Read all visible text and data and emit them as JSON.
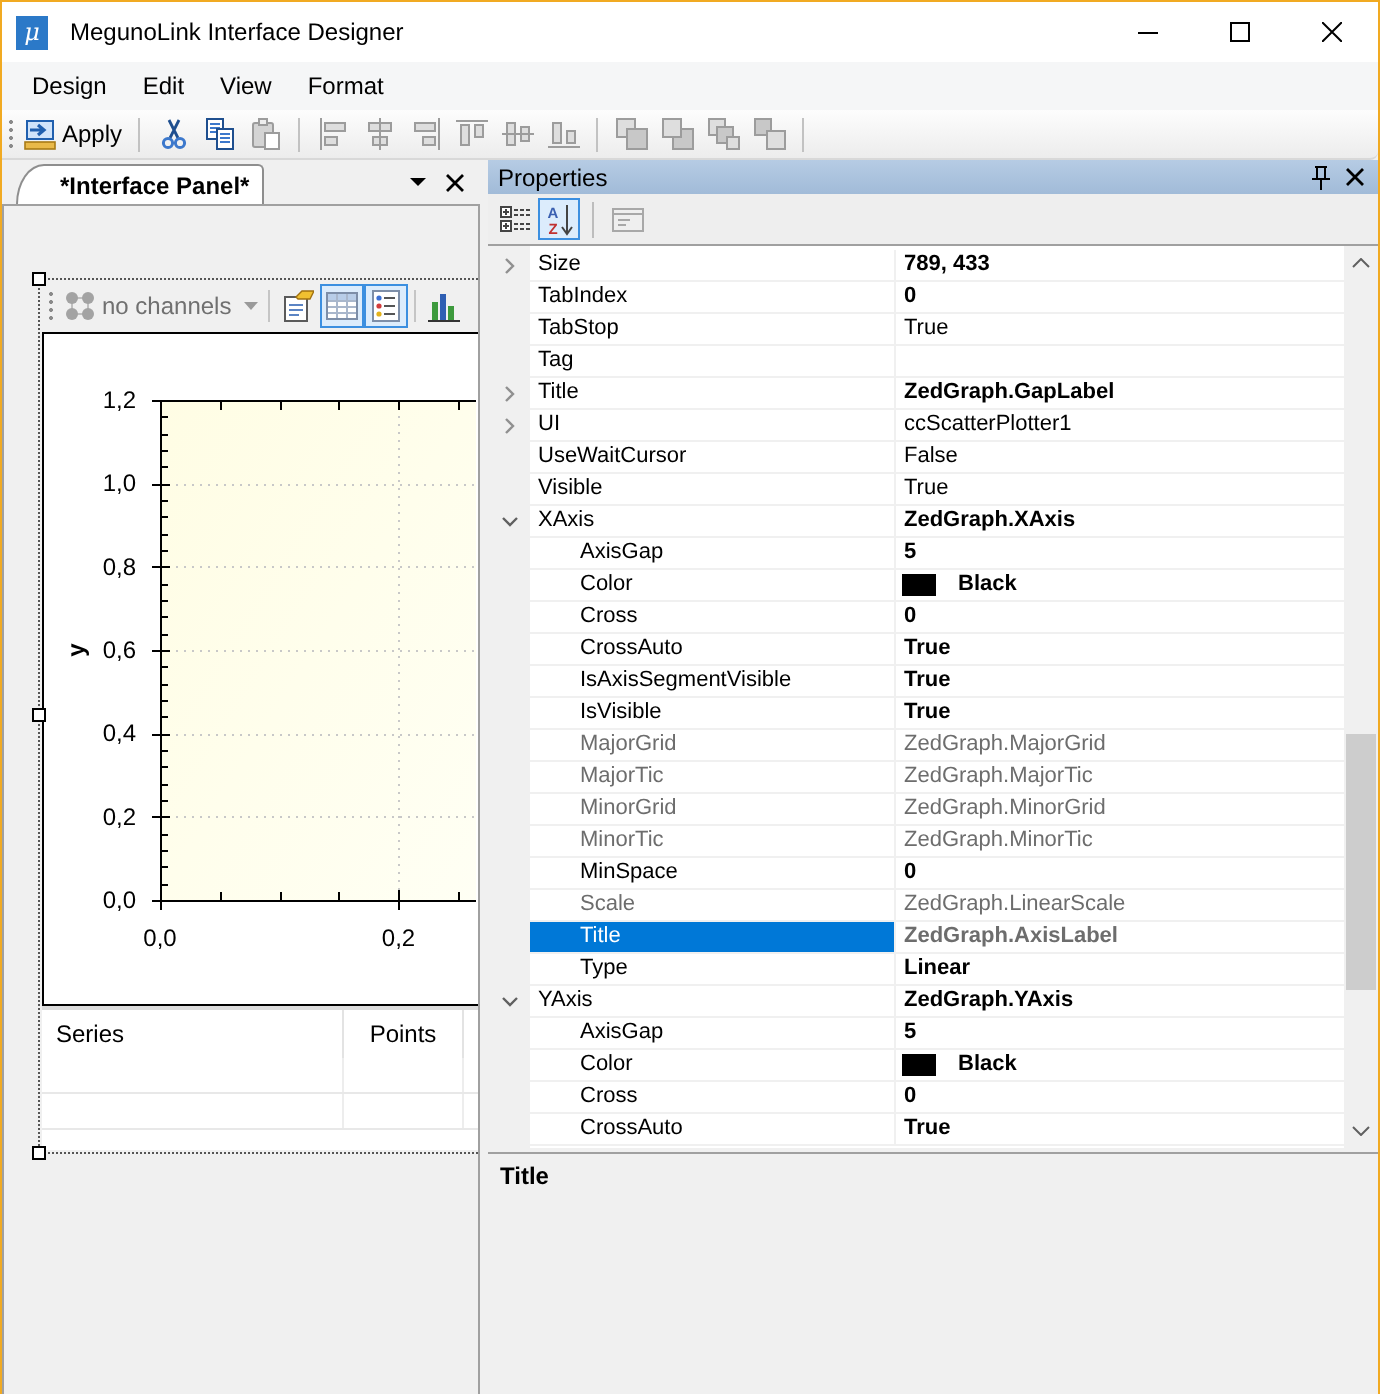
{
  "window": {
    "logo": "μ",
    "title": "MegunoLink Interface Designer"
  },
  "menu": [
    "Design",
    "Edit",
    "View",
    "Format"
  ],
  "toolbar": [
    {
      "kind": "apply",
      "label": "Apply",
      "disabled": false
    },
    {
      "kind": "separator"
    },
    {
      "kind": "cut",
      "disabled": false
    },
    {
      "kind": "copy",
      "disabled": false
    },
    {
      "kind": "paste",
      "disabled": true
    },
    {
      "kind": "separator"
    },
    {
      "kind": "align_left",
      "disabled": true
    },
    {
      "kind": "align_center",
      "disabled": true
    },
    {
      "kind": "align_right",
      "disabled": true
    },
    {
      "kind": "align_top",
      "disabled": true
    },
    {
      "kind": "align_middle",
      "disabled": true
    },
    {
      "kind": "align_bottom",
      "disabled": true
    },
    {
      "kind": "separator"
    },
    {
      "kind": "bring_to_front",
      "disabled": true
    },
    {
      "kind": "send_to_back",
      "disabled": true
    },
    {
      "kind": "bring_forward",
      "disabled": true
    },
    {
      "kind": "send_backward",
      "disabled": true
    },
    {
      "kind": "separator"
    }
  ],
  "document_tab": {
    "label": "*Interface Panel*",
    "selected": true
  },
  "chart_panel": {
    "toolbar": {
      "channels": {
        "label": "no channels",
        "disabled": true
      },
      "tools": [
        {
          "kind": "properties",
          "active": false
        },
        {
          "kind": "table",
          "active": true
        },
        {
          "kind": "legend",
          "active": true
        },
        {
          "kind": "bars",
          "active": false
        }
      ]
    },
    "chart_data": {
      "type": "scatter",
      "ylabel": "y",
      "xlim": [
        0,
        0.265
      ],
      "ylim": [
        0,
        1.2
      ],
      "grid": true,
      "xticks": [
        {
          "value": 0,
          "label": "0,0"
        },
        {
          "value": 0.2,
          "label": "0,2"
        }
      ],
      "yticks": [
        {
          "value": 0,
          "label": "0,0"
        },
        {
          "value": 0.2,
          "label": "0,2"
        },
        {
          "value": 0.4,
          "label": "0,4"
        },
        {
          "value": 0.6,
          "label": "0,6"
        },
        {
          "value": 0.8,
          "label": "0,8"
        },
        {
          "value": 1,
          "label": "1,0"
        },
        {
          "value": 1.2,
          "label": "1,2"
        }
      ]
    },
    "series_table": {
      "columns": [
        "Series",
        "Points"
      ]
    }
  },
  "properties_panel": {
    "title": "Properties",
    "toolbar": [
      {
        "kind": "categorized",
        "active": false,
        "disabled": false
      },
      {
        "kind": "alphabetical",
        "letters": [
          "A",
          "Z"
        ],
        "active": true,
        "disabled": false
      },
      {
        "kind": "property_pages",
        "active": false,
        "disabled": true
      }
    ],
    "properties": [
      {
        "name": "Size",
        "value": "789, 433",
        "modified": true,
        "readonly": false,
        "selected": false,
        "expanded": false
      },
      {
        "name": "TabIndex",
        "value": "0",
        "modified": true,
        "readonly": false,
        "selected": false
      },
      {
        "name": "TabStop",
        "value": "True",
        "modified": false,
        "readonly": false,
        "selected": false
      },
      {
        "name": "Tag",
        "readonly": false,
        "selected": false
      },
      {
        "name": "Title",
        "value": "ZedGraph.GapLabel",
        "modified": true,
        "readonly": false,
        "selected": false,
        "expanded": false
      },
      {
        "name": "UI",
        "value": "ccScatterPlotter1",
        "modified": false,
        "readonly": false,
        "selected": false,
        "expanded": false
      },
      {
        "name": "UseWaitCursor",
        "value": "False",
        "modified": false,
        "readonly": false,
        "selected": false
      },
      {
        "name": "Visible",
        "value": "True",
        "modified": false,
        "readonly": false,
        "selected": false
      },
      {
        "name": "XAxis",
        "value": "ZedGraph.XAxis",
        "modified": true,
        "readonly": false,
        "selected": false,
        "expanded": true,
        "children": [
          {
            "name": "AxisGap",
            "value": "5",
            "modified": true,
            "readonly": false,
            "selected": false
          },
          {
            "name": "Color",
            "value": "Black",
            "color": "#000000",
            "modified": true,
            "readonly": false,
            "selected": false
          },
          {
            "name": "Cross",
            "value": "0",
            "modified": true,
            "readonly": false,
            "selected": false
          },
          {
            "name": "CrossAuto",
            "value": "True",
            "modified": true,
            "readonly": false,
            "selected": false
          },
          {
            "name": "IsAxisSegmentVisible",
            "value": "True",
            "modified": true,
            "readonly": false,
            "selected": false
          },
          {
            "name": "IsVisible",
            "value": "True",
            "modified": true,
            "readonly": false,
            "selected": false
          },
          {
            "name": "MajorGrid",
            "value": "ZedGraph.MajorGrid",
            "modified": false,
            "readonly": true,
            "selected": false
          },
          {
            "name": "MajorTic",
            "value": "ZedGraph.MajorTic",
            "modified": false,
            "readonly": true,
            "selected": false
          },
          {
            "name": "MinorGrid",
            "value": "ZedGraph.MinorGrid",
            "modified": false,
            "readonly": true,
            "selected": false
          },
          {
            "name": "MinorTic",
            "value": "ZedGraph.MinorTic",
            "modified": false,
            "readonly": true,
            "selected": false
          },
          {
            "name": "MinSpace",
            "value": "0",
            "modified": true,
            "readonly": false,
            "selected": false
          },
          {
            "name": "Scale",
            "value": "ZedGraph.LinearScale",
            "modified": false,
            "readonly": true,
            "selected": false
          },
          {
            "name": "Title",
            "value": "ZedGraph.AxisLabel",
            "modified": true,
            "readonly": true,
            "selected": true
          },
          {
            "name": "Type",
            "value": "Linear",
            "modified": true,
            "readonly": false,
            "selected": false
          }
        ]
      },
      {
        "name": "YAxis",
        "value": "ZedGraph.YAxis",
        "modified": true,
        "readonly": false,
        "selected": false,
        "expanded": true,
        "children": [
          {
            "name": "AxisGap",
            "value": "5",
            "modified": true,
            "readonly": false,
            "selected": false
          },
          {
            "name": "Color",
            "value": "Black",
            "color": "#000000",
            "modified": true,
            "readonly": false,
            "selected": false
          },
          {
            "name": "Cross",
            "value": "0",
            "modified": true,
            "readonly": false,
            "selected": false
          },
          {
            "name": "CrossAuto",
            "value": "True",
            "modified": true,
            "readonly": false,
            "selected": false
          }
        ]
      }
    ],
    "description": {
      "title": "Title"
    }
  }
}
